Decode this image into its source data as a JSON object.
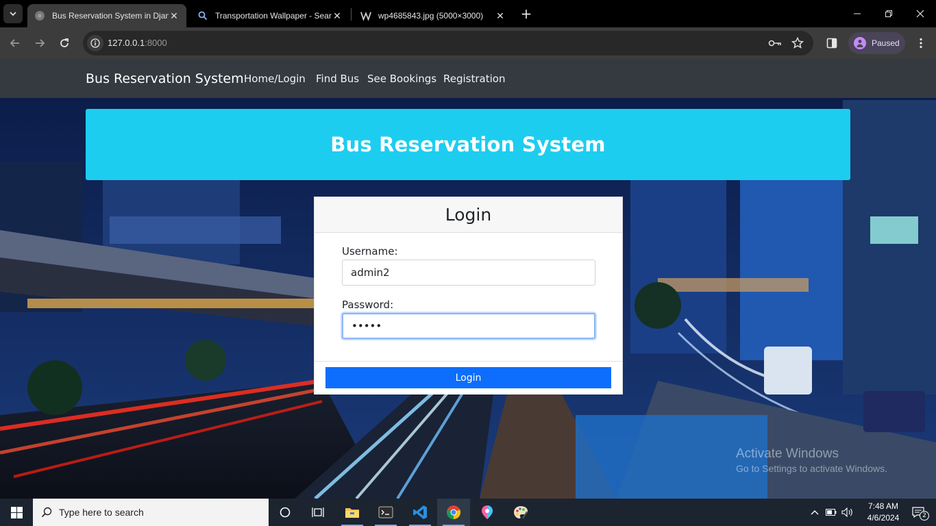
{
  "browser": {
    "tabs": [
      {
        "title": "Bus Reservation System in Django",
        "active": true,
        "favicon": "globe-icon"
      },
      {
        "title": "Transportation Wallpaper - Search",
        "active": false,
        "favicon": "search-icon"
      },
      {
        "title": "wp4685843.jpg (5000×3000)",
        "active": false,
        "favicon": "w-logo-icon"
      }
    ],
    "url_host": "127.0.0.1",
    "url_port": ":8000",
    "profile_label": "Paused"
  },
  "site": {
    "brand": "Bus Reservation System",
    "nav": [
      "Home/Login",
      "Find Bus",
      "See Bookings",
      "Registration"
    ],
    "banner_title": "Bus Reservation System"
  },
  "login": {
    "title": "Login",
    "username_label": "Username:",
    "username_value": "admin2",
    "password_label": "Password:",
    "password_value": "•••••",
    "submit_label": "Login"
  },
  "watermark": {
    "line1": "Activate Windows",
    "line2": "Go to Settings to activate Windows."
  },
  "taskbar": {
    "search_placeholder": "Type here to search",
    "time": "7:48 AM",
    "date": "4/6/2024",
    "notification_count": "2"
  }
}
